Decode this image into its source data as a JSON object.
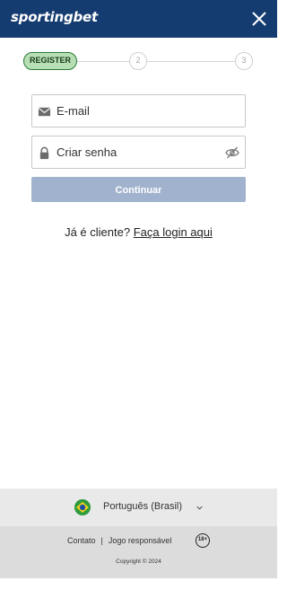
{
  "header": {
    "logo_text": "sportingbet",
    "close_icon": "close-icon"
  },
  "stepper": {
    "active_label": "REGISTER",
    "steps": [
      "2",
      "3"
    ]
  },
  "form": {
    "email_placeholder": "E-mail",
    "email_icon": "envelope-icon",
    "password_placeholder": "Criar senha",
    "password_icon": "lock-icon",
    "visibility_icon": "eye-off-icon",
    "continue_label": "Continuar"
  },
  "login": {
    "prompt": "Já é cliente?",
    "link": "Faça login aqui"
  },
  "language": {
    "flag_icon": "brazil-flag-icon",
    "label": "Português (Brasil)",
    "chevron_icon": "chevron-down-icon"
  },
  "footer": {
    "contact": "Contato",
    "separator": "|",
    "responsible": "Jogo responsável",
    "age_badge": "18+",
    "copyright": "Copyright © 2024"
  },
  "colors": {
    "header_bg": "#153c70",
    "step_active": "#b7dfb4",
    "button_disabled": "#a0b2cd"
  }
}
